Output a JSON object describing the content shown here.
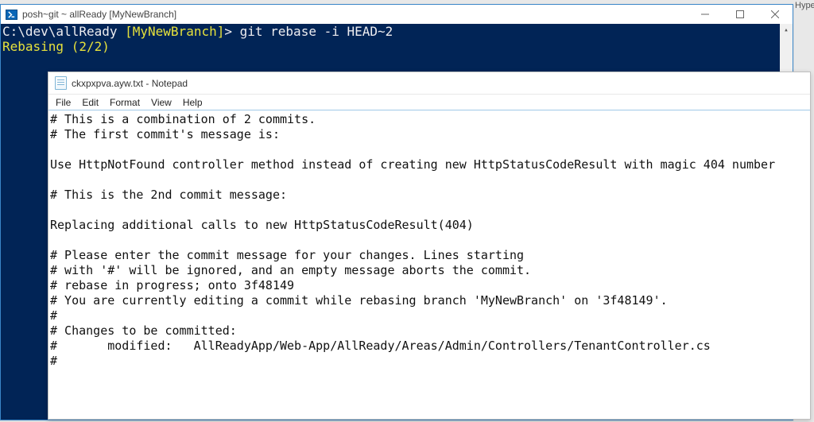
{
  "side_label": "Hype",
  "ps": {
    "title": "posh~git ~ allReady [MyNewBranch]",
    "prompt_path": "C:\\dev\\allReady ",
    "prompt_branch": "[MyNewBranch]",
    "prompt_gt": "> ",
    "command": "git rebase -i HEAD~2",
    "status_line": "Rebasing (2/2)"
  },
  "np": {
    "title": "ckxpxpva.ayw.txt - Notepad",
    "menu": {
      "file": "File",
      "edit": "Edit",
      "format": "Format",
      "view": "View",
      "help": "Help"
    },
    "content": "# This is a combination of 2 commits.\n# The first commit's message is:\n\nUse HttpNotFound controller method instead of creating new HttpStatusCodeResult with magic 404 number\n\n# This is the 2nd commit message:\n\nReplacing additional calls to new HttpStatusCodeResult(404)\n\n# Please enter the commit message for your changes. Lines starting\n# with '#' will be ignored, and an empty message aborts the commit.\n# rebase in progress; onto 3f48149\n# You are currently editing a commit while rebasing branch 'MyNewBranch' on '3f48149'.\n#\n# Changes to be committed:\n#       modified:   AllReadyApp/Web-App/AllReady/Areas/Admin/Controllers/TenantController.cs\n#"
  }
}
